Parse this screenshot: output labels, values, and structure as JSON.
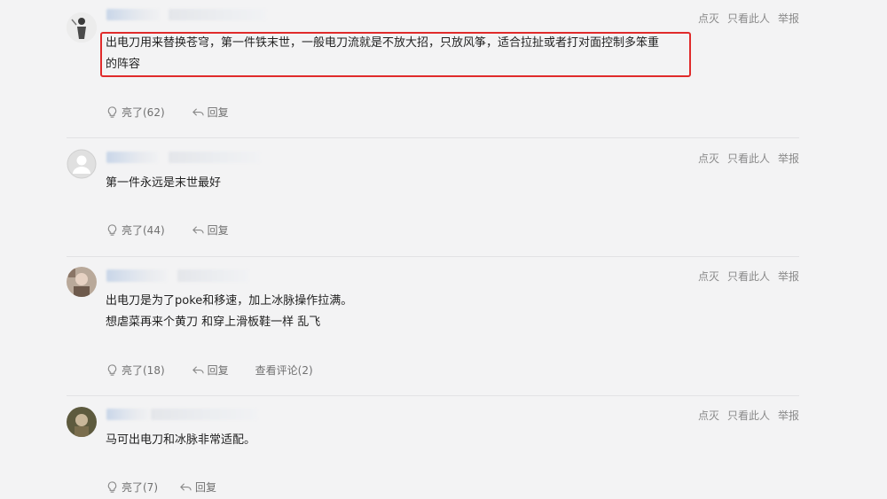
{
  "top_actions": {
    "like_light": "点灭",
    "only_this": "只看此人",
    "report": "举报"
  },
  "comments": [
    {
      "lines": [
        "出电刀用来替换苍穹，第一件铁末世，一般电刀流就是不放大招，只放风筝，适合拉扯或者打对面控制多笨重",
        "的阵容"
      ],
      "likes": "亮了(62)",
      "reply": "回复"
    },
    {
      "lines": [
        "第一件永远是末世最好"
      ],
      "likes": "亮了(44)",
      "reply": "回复"
    },
    {
      "lines": [
        "出电刀是为了poke和移速，加上冰脉操作拉满。",
        "想虐菜再来个黄刀 和穿上滑板鞋一样 乱飞"
      ],
      "likes": "亮了(18)",
      "reply": "回复",
      "view_comments": "查看评论(2)"
    },
    {
      "lines": [
        "马可出电刀和冰脉非常适配。"
      ],
      "likes": "亮了(7)",
      "reply": "回复"
    }
  ],
  "colors": {
    "highlight_border": "#e02b2b",
    "background": "#f3f3f4"
  }
}
